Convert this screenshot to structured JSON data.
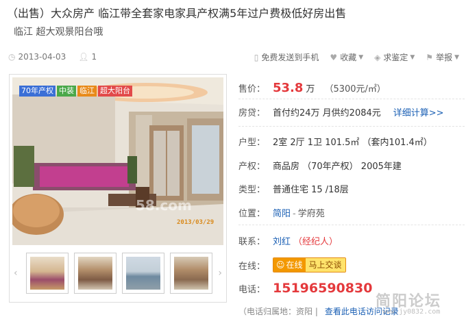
{
  "header": {
    "title": "（出售）大众房产  临江带全套家电家具产权满5年过户费极低好房出售",
    "subtitle": "临江  超大观景阳台哦"
  },
  "meta": {
    "date": "2013-04-03",
    "views": "1",
    "actions": [
      {
        "label": "免费发送到手机",
        "icon": "phone-icon"
      },
      {
        "label": "收藏",
        "icon": "heart-icon"
      },
      {
        "label": "求鉴定",
        "icon": "tag-icon"
      },
      {
        "label": "举报",
        "icon": "flag-icon"
      }
    ]
  },
  "gallery": {
    "tags": [
      {
        "label": "70年产权",
        "color": "#3b6fd6"
      },
      {
        "label": "中装",
        "color": "#4aa84a"
      },
      {
        "label": "临江",
        "color": "#e88a1a"
      },
      {
        "label": "超大阳台",
        "color": "#e24a4a"
      }
    ],
    "photo_date": "2013/03/29",
    "photo_logo": "58.com"
  },
  "info": {
    "price": {
      "label": "售价：",
      "value": "53.8",
      "unit": "万",
      "per_sqm": "（5300元/㎡）"
    },
    "loan": {
      "label": "房贷：",
      "text": "首付约24万 月供约2084元",
      "link": "详细计算>>"
    },
    "layout": {
      "label": "户型：",
      "text": "2室 2厅 1卫   101.5㎡ （套内101.4㎡）"
    },
    "ownership": {
      "label": "产权：",
      "text": "商品房    （70年产权）     2005年建"
    },
    "type": {
      "label": "类型：",
      "text": "普通住宅      15 /18层"
    },
    "location": {
      "label": "位置：",
      "district": "简阳",
      "area": "学府苑"
    },
    "contact": {
      "label": "联系：",
      "name": "刘红",
      "role": "（经纪人）"
    },
    "online": {
      "label": "在线：",
      "btn_a": "在线",
      "btn_b": "马上交谈"
    },
    "phone": {
      "label": "电话：",
      "number": "15196590830"
    },
    "phone_note": {
      "text": "（电话归属地：资阳  |",
      "link": "查看此电话访问记录"
    }
  },
  "site_watermark": {
    "cn": "简阳论坛",
    "url": "www.jy0832.com"
  }
}
